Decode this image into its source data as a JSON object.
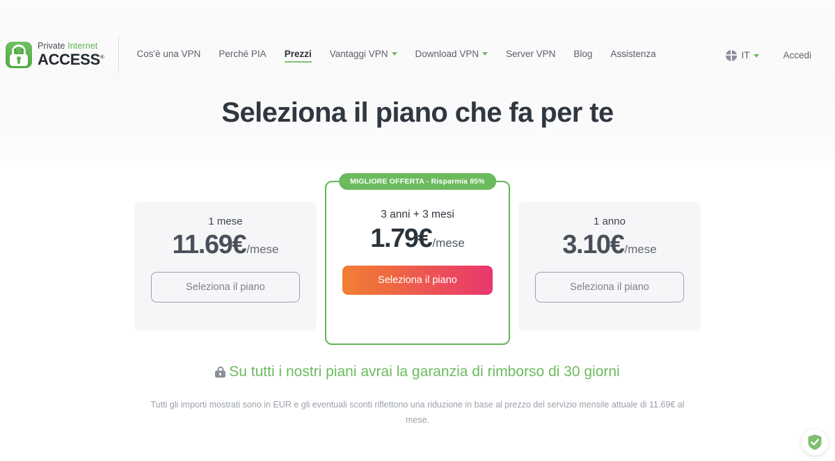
{
  "brand": {
    "logo_line1_word1": "Private",
    "logo_line1_word2": "Internet",
    "logo_line2": "ACCESS",
    "logo_registered": "®",
    "logo_icon": "padlock-smiley-icon",
    "accent_green": "#6cba5e",
    "dark_text": "#2f3740"
  },
  "nav": {
    "items": [
      {
        "label": "Cos'è una VPN",
        "has_caret": false,
        "active": false
      },
      {
        "label": "Perché PIA",
        "has_caret": false,
        "active": false
      },
      {
        "label": "Prezzi",
        "has_caret": false,
        "active": true
      },
      {
        "label": "Vantaggi VPN",
        "has_caret": true,
        "active": false
      },
      {
        "label": "Download VPN",
        "has_caret": true,
        "active": false
      },
      {
        "label": "Server VPN",
        "has_caret": false,
        "active": false
      },
      {
        "label": "Blog",
        "has_caret": false,
        "active": false
      },
      {
        "label": "Assistenza",
        "has_caret": false,
        "active": false
      }
    ]
  },
  "header_right": {
    "language_label": "IT",
    "language_icon": "globe-icon",
    "language_caret": "chevron-down-icon",
    "login_label": "Accedi"
  },
  "hero": {
    "title": "Seleziona il piano che fa per te"
  },
  "plans": [
    {
      "term": "1 mese",
      "price": "11.69€",
      "per": "/mese",
      "cta": "Seleziona il piano",
      "featured": false,
      "badge": null
    },
    {
      "term": "3 anni + 3 mesi",
      "price": "1.79€",
      "per": "/mese",
      "cta": "Seleziona il piano",
      "featured": true,
      "badge": "MIGLIORE OFFERTA - Risparmia 85%"
    },
    {
      "term": "1 anno",
      "price": "3.10€",
      "per": "/mese",
      "cta": "Seleziona il piano",
      "featured": false,
      "badge": null
    }
  ],
  "guarantee": {
    "icon": "lock-icon",
    "text": "Su tutti i nostri piani avrai la garanzia di rimborso di 30 giorni"
  },
  "disclaimer": {
    "text": "Tutti gli importi mostrati sono in EUR e gli eventuali sconti riflettono una riduzione in base al prezzo del servizio mensile attuale di 11.69€ al mese."
  },
  "widget": {
    "name": "adguard-shield-icon"
  }
}
